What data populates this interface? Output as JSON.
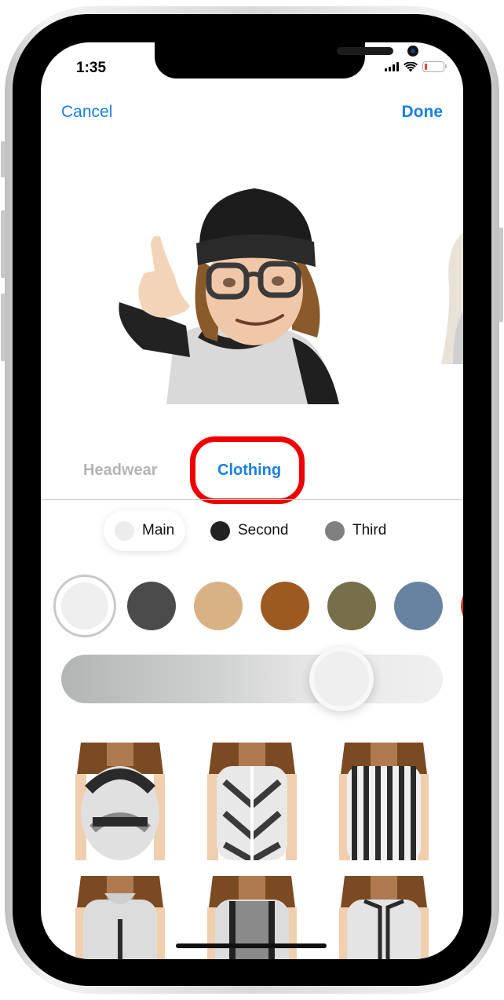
{
  "status_bar": {
    "time": "1:35",
    "signal_bars": 4,
    "wifi": true,
    "battery_level_percent": 8,
    "battery_color": "#ff3b30"
  },
  "nav": {
    "cancel_label": "Cancel",
    "done_label": "Done",
    "accent_color": "#1a7fe5"
  },
  "preview": {
    "main_avatar_alt": "Memoji wearing black beanie, glasses, raglan shirt, call-me gesture",
    "next_avatar_alt": "Partially visible next Memoji"
  },
  "category_tabs": [
    {
      "label": "Headwear",
      "selected": false
    },
    {
      "label": "Clothing",
      "selected": true,
      "highlighted": true
    }
  ],
  "color_target_chips": [
    {
      "label": "Main",
      "color": "#ececec",
      "selected": true
    },
    {
      "label": "Second",
      "color": "#222222",
      "selected": false
    },
    {
      "label": "Third",
      "color": "#808080",
      "selected": false
    }
  ],
  "swatches": [
    {
      "name": "light-gray",
      "color": "#efefef",
      "selected": true
    },
    {
      "name": "charcoal",
      "color": "#4b4b4b",
      "selected": false
    },
    {
      "name": "tan",
      "color": "#d8b285",
      "selected": false
    },
    {
      "name": "rust-brown",
      "color": "#9c5a20",
      "selected": false
    },
    {
      "name": "olive",
      "color": "#776e4a",
      "selected": false
    },
    {
      "name": "slate-blue",
      "color": "#6883a2",
      "selected": false
    },
    {
      "name": "red-orange",
      "color": "#d8391a",
      "selected": false
    }
  ],
  "shade_slider": {
    "value_fraction": 0.77
  },
  "clothing_options": [
    {
      "name": "swirl-pattern-dress",
      "selected": false
    },
    {
      "name": "geometric-pattern-tunic",
      "selected": false
    },
    {
      "name": "vertical-stripe-dress",
      "selected": false
    },
    {
      "name": "hoodie-with-buttons",
      "selected": false
    },
    {
      "name": "studded-tunic",
      "selected": false
    },
    {
      "name": "striped-trim-robe",
      "selected": false
    }
  ]
}
